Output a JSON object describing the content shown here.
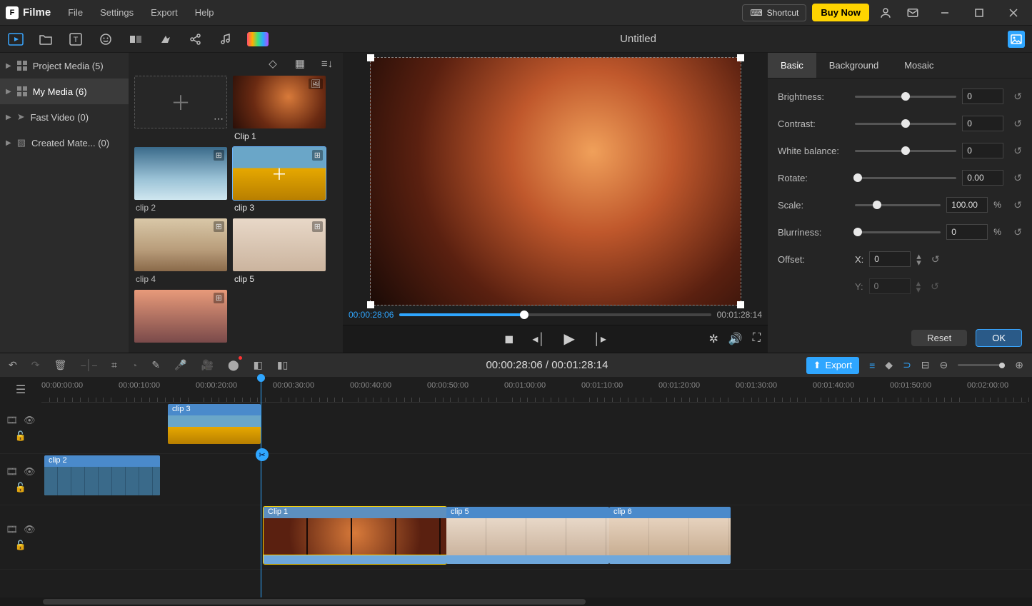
{
  "titlebar": {
    "app_name": "Filme",
    "menu": {
      "file": "File",
      "settings": "Settings",
      "export": "Export",
      "help": "Help"
    },
    "shortcut": "Shortcut",
    "buy": "Buy Now"
  },
  "project_title": "Untitled",
  "sidebar": {
    "items": [
      {
        "label": "Project Media (5)"
      },
      {
        "label": "My Media (6)"
      },
      {
        "label": "Fast Video (0)"
      },
      {
        "label": "Created Mate... (0)"
      }
    ]
  },
  "media": {
    "clips": [
      {
        "label": "Clip 1",
        "bold": true
      },
      {
        "label": "clip 2"
      },
      {
        "label": "clip 3",
        "bold": true,
        "selected": true
      },
      {
        "label": "clip 4"
      },
      {
        "label": "clip 5",
        "bold": true
      }
    ]
  },
  "preview": {
    "time_current": "00:00:28:06",
    "time_total": "00:01:28:14"
  },
  "props": {
    "tabs": {
      "basic": "Basic",
      "background": "Background",
      "mosaic": "Mosaic"
    },
    "brightness": {
      "label": "Brightness:",
      "value": "0"
    },
    "contrast": {
      "label": "Contrast:",
      "value": "0"
    },
    "white": {
      "label": "White balance:",
      "value": "0"
    },
    "rotate": {
      "label": "Rotate:",
      "value": "0.00"
    },
    "scale": {
      "label": "Scale:",
      "value": "100.00",
      "suffix": "%"
    },
    "blur": {
      "label": "Blurriness:",
      "value": "0",
      "suffix": "%"
    },
    "offset": {
      "label": "Offset:",
      "x_label": "X:",
      "x": "0",
      "y_label": "Y:",
      "y": "0"
    },
    "reset_btn": "Reset",
    "ok_btn": "OK"
  },
  "tl_toolbar": {
    "time_display": "00:00:28:06 / 00:01:28:14",
    "export": "Export"
  },
  "ruler": {
    "ticks": [
      "00:00:00:00",
      "00:00:10:00",
      "00:00:20:00",
      "00:00:30:00",
      "00:00:40:00",
      "00:00:50:00",
      "00:01:00:00",
      "00:01:10:00",
      "00:01:20:00",
      "00:01:30:00",
      "00:01:40:00",
      "00:01:50:00",
      "00:02:00:00"
    ]
  },
  "tracks": {
    "t1": {
      "clip3": {
        "label": "clip 3"
      }
    },
    "t2": {
      "clip2": {
        "label": "clip 2"
      }
    },
    "t3": {
      "clip1": {
        "label": "Clip 1"
      },
      "clip5": {
        "label": "clip 5"
      },
      "clip6": {
        "label": "clip 6"
      }
    }
  }
}
